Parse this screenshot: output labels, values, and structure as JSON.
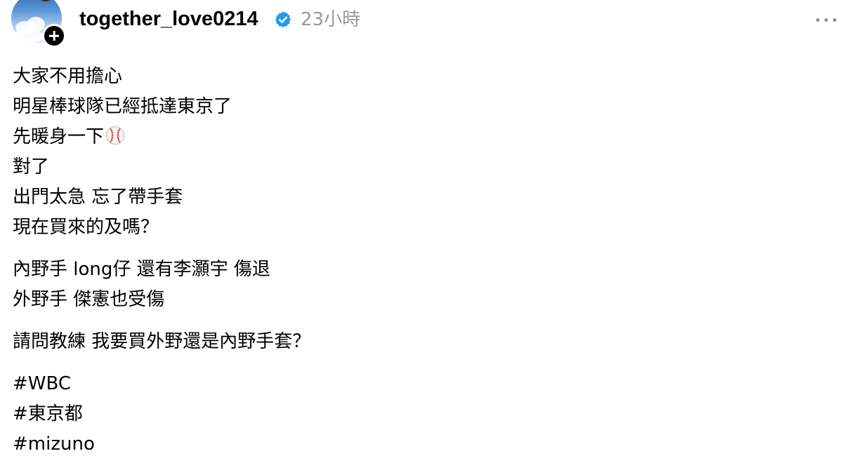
{
  "post": {
    "username": "together_love0214",
    "timestamp": "23小時",
    "icons": {
      "avatar": "profile-avatar",
      "follow": "plus-icon",
      "verified": "verified-badge-icon",
      "more": "more-options-icon",
      "baseball": "baseball-emoji-icon"
    },
    "colors": {
      "verified": "#1d9bf0",
      "timestamp": "#9a9a9a",
      "more": "#8e8e8e"
    },
    "body": {
      "para1": [
        "大家不用擔心",
        "明星棒球隊已經抵達東京了",
        "先暖身一下",
        "對了",
        "出門太急 忘了帶手套",
        "現在買來的及嗎？"
      ],
      "para2": [
        "內野手 long仔 還有李灝宇 傷退",
        "外野手 傑憲也受傷"
      ],
      "para3": [
        "請問教練 我要買外野還是內野手套？"
      ],
      "hashtags": [
        "#WBC",
        "#東京都",
        "#mizuno"
      ]
    }
  }
}
